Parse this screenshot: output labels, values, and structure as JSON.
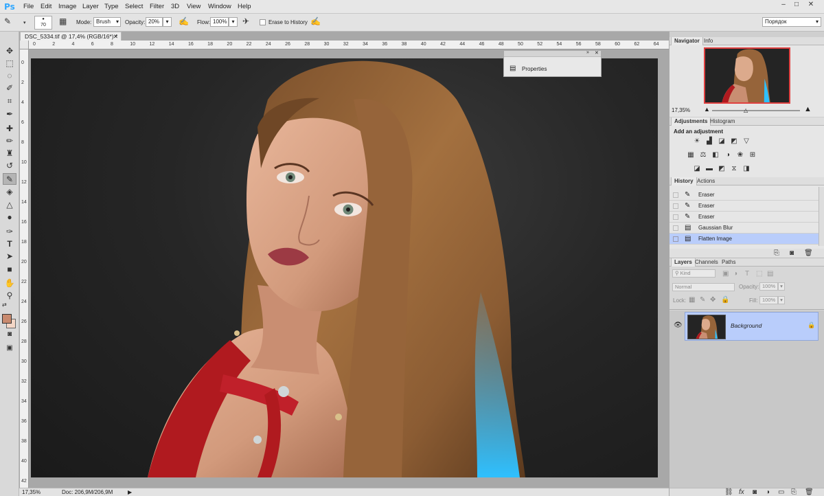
{
  "app": {
    "logo": "Ps"
  },
  "menu": [
    "File",
    "Edit",
    "Image",
    "Layer",
    "Type",
    "Select",
    "Filter",
    "3D",
    "View",
    "Window",
    "Help"
  ],
  "window_controls": {
    "minimize": "–",
    "maximize": "□",
    "close": "✕"
  },
  "options": {
    "brush_size": "70",
    "mode_label": "Mode:",
    "mode_value": "Brush",
    "opacity_label": "Opacity:",
    "opacity_value": "20%",
    "flow_label": "Flow:",
    "flow_value": "100%",
    "erase_history_label": "Erase to History",
    "workspace": "Порядок"
  },
  "document": {
    "tab_title": "DSC_5334.tif @ 17,4% (RGB/16*) *",
    "zoom": "17,35%",
    "doc_info": "Doc: 206,9M/206,9M"
  },
  "ruler": {
    "h_ticks": [
      "0",
      "2",
      "4",
      "6",
      "8",
      "10",
      "12",
      "14",
      "16",
      "18",
      "20",
      "22",
      "24",
      "26",
      "28",
      "30",
      "32",
      "34",
      "36",
      "38",
      "40",
      "42",
      "44",
      "46",
      "48",
      "50",
      "52",
      "54",
      "56",
      "58",
      "60",
      "62",
      "64"
    ],
    "v_ticks": [
      "0",
      "2",
      "4",
      "6",
      "8",
      "10",
      "12",
      "14",
      "16",
      "18",
      "20",
      "22",
      "24",
      "26",
      "28",
      "30",
      "32",
      "34",
      "36",
      "38",
      "40",
      "42"
    ]
  },
  "properties_panel": {
    "label": "Properties"
  },
  "navigator": {
    "tabs": [
      "Navigator",
      "Info"
    ],
    "zoom": "17,35%"
  },
  "adjustments": {
    "tabs": [
      "Adjustments",
      "Histogram"
    ],
    "title": "Add an adjustment",
    "row1": [
      "brightness-icon",
      "levels-icon",
      "curves-icon",
      "exposure-icon",
      "triangle-icon"
    ],
    "row2": [
      "vibrance-icon",
      "hue-icon",
      "colorbalance-icon",
      "bw-icon",
      "photofilter-icon",
      "mixer-icon",
      "lookup-icon"
    ],
    "row3": [
      "invert-icon",
      "posterize-icon",
      "threshold-icon",
      "selectivecolor-icon",
      "gradientmap-icon"
    ]
  },
  "history": {
    "tabs": [
      "History",
      "Actions"
    ],
    "items": [
      "Eraser",
      "Eraser",
      "Eraser",
      "Gaussian Blur",
      "Flatten Image"
    ]
  },
  "layers": {
    "tabs": [
      "Layers",
      "Channels",
      "Paths"
    ],
    "kind_label": "Kind",
    "blend_mode": "Normal",
    "opacity_label": "Opacity:",
    "opacity_value": "100%",
    "lock_label": "Lock:",
    "fill_label": "Fill:",
    "fill_value": "100%",
    "layer_name": "Background"
  },
  "colors": {
    "foreground": "#c98a6f",
    "background": "#f3d6c6",
    "selection": "#b9cdfb",
    "accent": "#31a8ff"
  }
}
